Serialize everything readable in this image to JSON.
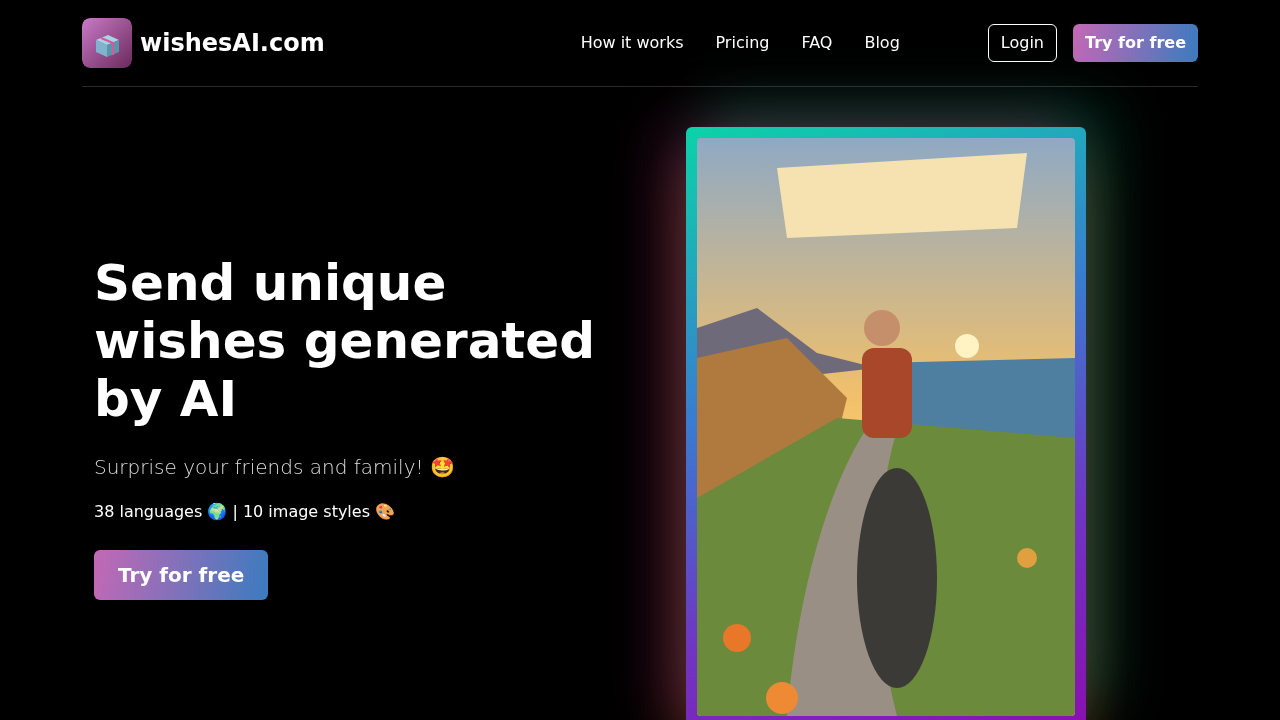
{
  "brand": {
    "name": "wishesAI.com"
  },
  "nav": [
    {
      "label": "How it works"
    },
    {
      "label": "Pricing"
    },
    {
      "label": "FAQ"
    },
    {
      "label": "Blog"
    }
  ],
  "header_buttons": [
    {
      "kind": "outline",
      "label": "Login"
    },
    {
      "kind": "gradient",
      "label": "Try for free"
    }
  ],
  "hero": {
    "title": "Send unique wishes generated by AI",
    "subtitle": "Surprise your friends and family! 🤩",
    "features": "38 languages 🌍 | 10 image styles 🎨",
    "cta": "Try for free"
  }
}
